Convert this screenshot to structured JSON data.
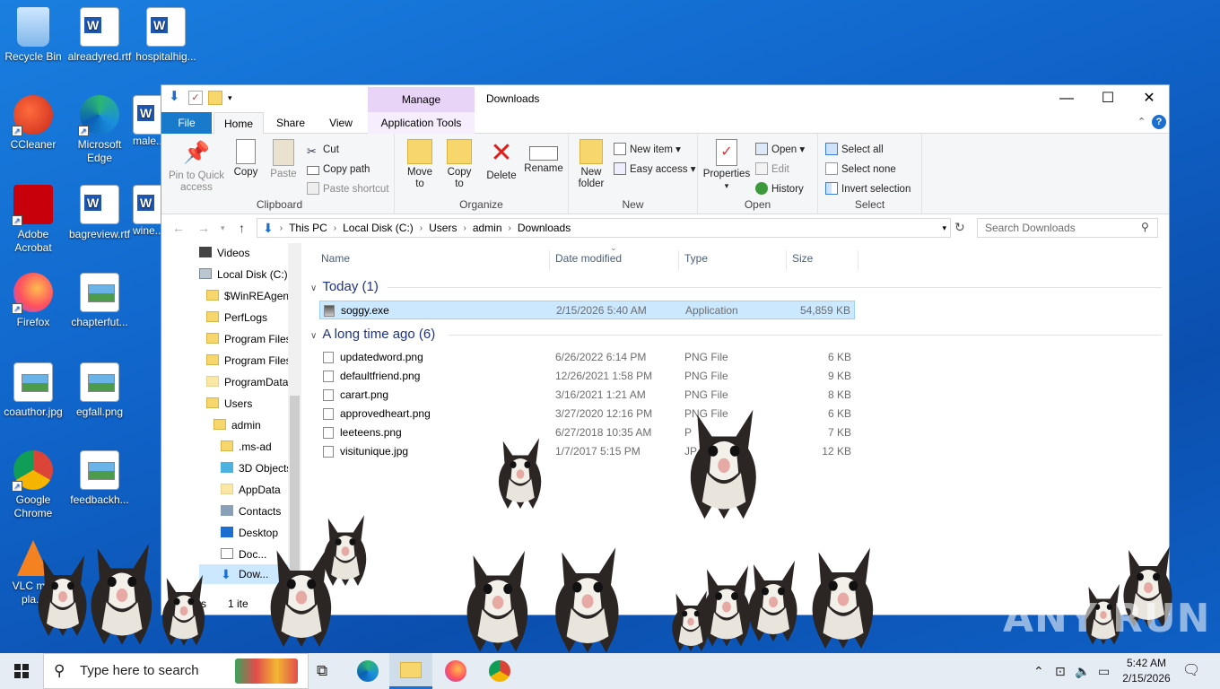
{
  "desktop": {
    "icons": [
      {
        "label": "Recycle Bin"
      },
      {
        "label": "alreadyred.rtf"
      },
      {
        "label": "hospitalhig..."
      },
      {
        "label": "CCleaner"
      },
      {
        "label": "Microsoft Edge"
      },
      {
        "label": "male..."
      },
      {
        "label": "Adobe Acrobat"
      },
      {
        "label": "bagreview.rtf"
      },
      {
        "label": "wine..."
      },
      {
        "label": "Firefox"
      },
      {
        "label": "chapterfut..."
      },
      {
        "label": "coauthor.jpg"
      },
      {
        "label": "egfall.png"
      },
      {
        "label": "Google Chrome"
      },
      {
        "label": "feedbackh..."
      },
      {
        "label": "VLC m... pla..."
      }
    ]
  },
  "window": {
    "title": "Downloads",
    "manage_label": "Manage",
    "tabs": {
      "file": "File",
      "home": "Home",
      "share": "Share",
      "view": "View",
      "app_tools": "Application Tools"
    },
    "ribbon": {
      "clipboard": {
        "label": "Clipboard",
        "pin": "Pin to Quick access",
        "copy": "Copy",
        "paste": "Paste",
        "cut": "Cut",
        "copy_path": "Copy path",
        "paste_shortcut": "Paste shortcut"
      },
      "organize": {
        "label": "Organize",
        "move_to": "Move to",
        "copy_to": "Copy to",
        "delete": "Delete",
        "rename": "Rename"
      },
      "new": {
        "label": "New",
        "new_folder": "New folder",
        "new_item": "New item",
        "easy_access": "Easy access"
      },
      "open": {
        "label": "Open",
        "properties": "Properties",
        "open": "Open",
        "edit": "Edit",
        "history": "History"
      },
      "select": {
        "label": "Select",
        "select_all": "Select all",
        "select_none": "Select none",
        "invert": "Invert selection"
      }
    },
    "address": [
      "This PC",
      "Local Disk (C:)",
      "Users",
      "admin",
      "Downloads"
    ],
    "search_placeholder": "Search Downloads",
    "nav": [
      "Videos",
      "Local Disk (C:)",
      "$WinREAgent",
      "PerfLogs",
      "Program Files",
      "Program Files",
      "ProgramData",
      "Users",
      "admin",
      ".ms-ad",
      "3D Objects",
      "AppData",
      "Contacts",
      "Desktop",
      "Doc...",
      "Dow..."
    ],
    "columns": {
      "name": "Name",
      "date": "Date modified",
      "type": "Type",
      "size": "Size"
    },
    "groups": [
      {
        "header": "Today (1)",
        "files": [
          {
            "name": "soggy.exe",
            "date": "2/15/2026 5:40 AM",
            "type": "Application",
            "size": "54,859 KB"
          }
        ]
      },
      {
        "header": "A long time ago (6)",
        "files": [
          {
            "name": "updatedword.png",
            "date": "6/26/2022 6:14 PM",
            "type": "PNG File",
            "size": "6 KB"
          },
          {
            "name": "defaultfriend.png",
            "date": "12/26/2021 1:58 PM",
            "type": "PNG File",
            "size": "9 KB"
          },
          {
            "name": "carart.png",
            "date": "3/16/2021 1:21 AM",
            "type": "PNG File",
            "size": "8 KB"
          },
          {
            "name": "approvedheart.png",
            "date": "3/27/2020 12:16 PM",
            "type": "PNG File",
            "size": "6 KB"
          },
          {
            "name": "leeteens.png",
            "date": "6/27/2018 10:35 AM",
            "type": "P",
            "size": "7 KB"
          },
          {
            "name": "visitunique.jpg",
            "date": "1/7/2017 5:15 PM",
            "type": "JP",
            "size": "12 KB"
          }
        ]
      }
    ],
    "status": {
      "items": "ms",
      "selected": "1 ite"
    }
  },
  "taskbar": {
    "search_placeholder": "Type here to search",
    "clock_time": "5:42 AM",
    "clock_date": "2/15/2026"
  },
  "watermark": "ANY RUN"
}
